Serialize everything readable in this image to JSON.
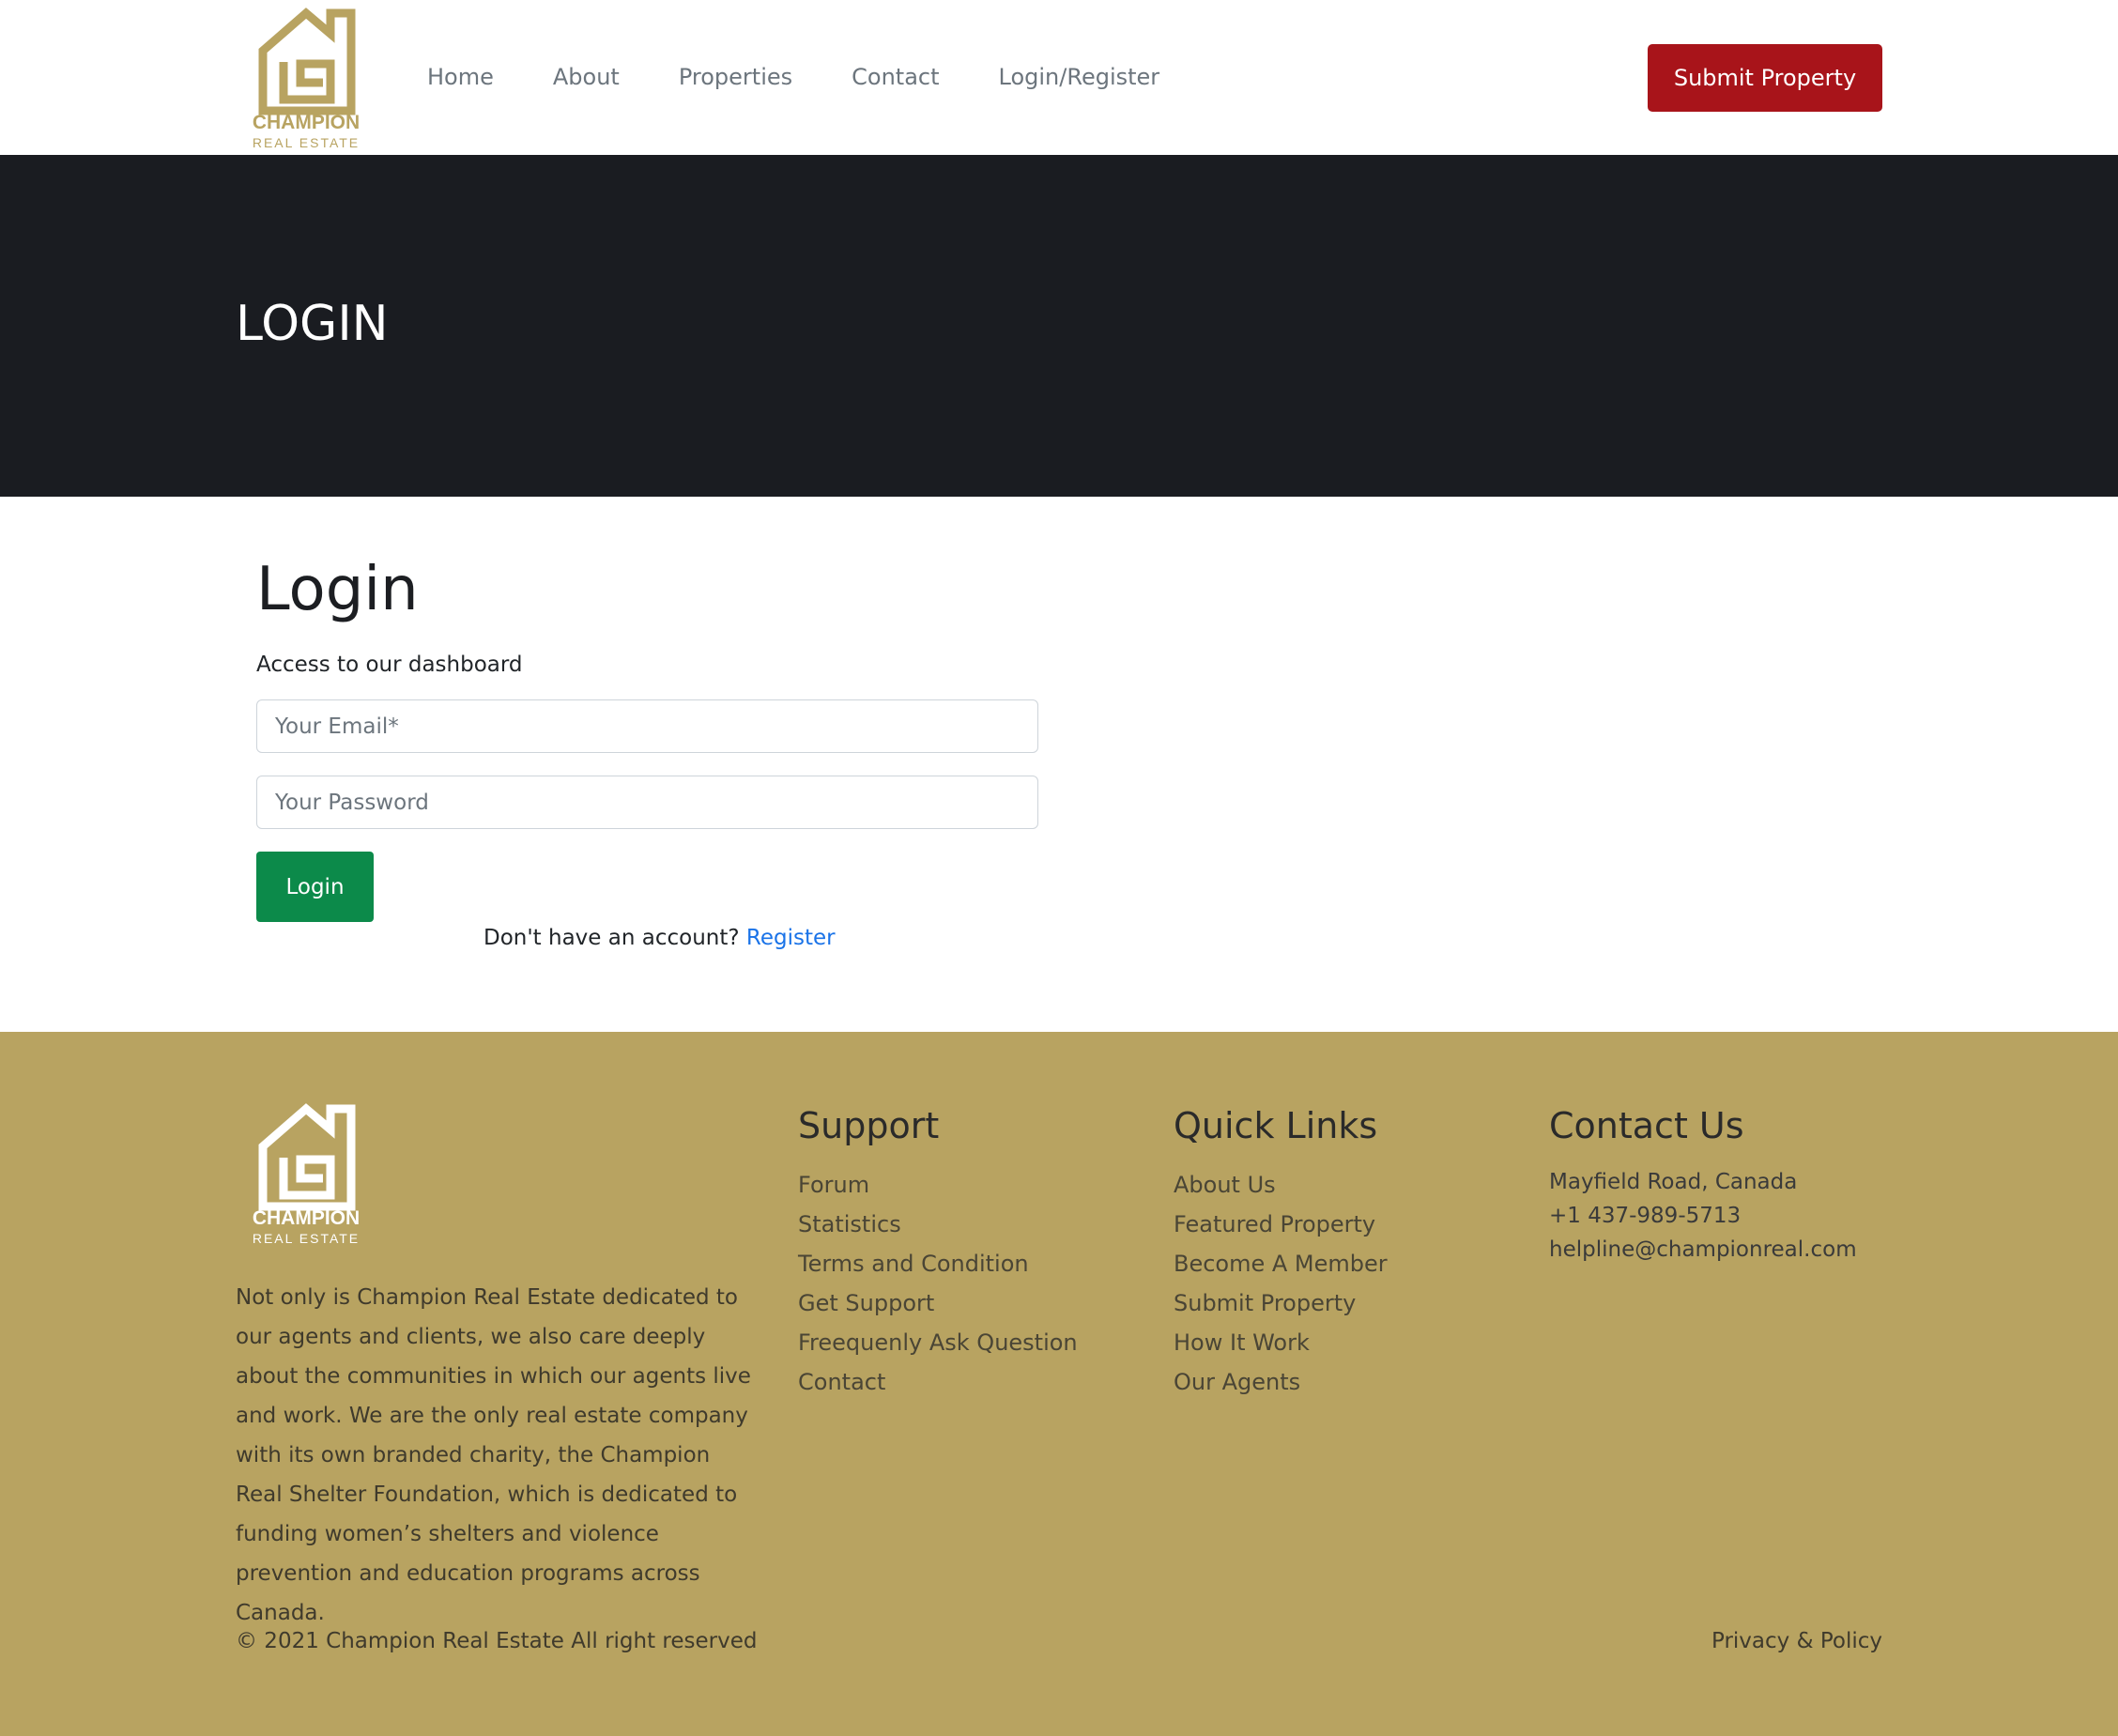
{
  "header": {
    "logo": {
      "brand": "CHAMPION",
      "tagline": "REAL ESTATE",
      "color": "#b8a361"
    },
    "nav": [
      {
        "label": "Home"
      },
      {
        "label": "About"
      },
      {
        "label": "Properties"
      },
      {
        "label": "Contact"
      },
      {
        "label": "Login/Register"
      }
    ],
    "submit_button": "Submit Property",
    "submit_button_color": "#a8141a"
  },
  "banner": {
    "title": "LOGIN",
    "background": "#1a1c21"
  },
  "login": {
    "heading": "Login",
    "subtitle": "Access to our dashboard",
    "email_placeholder": "Your Email*",
    "password_placeholder": "Your Password",
    "login_button": "Login",
    "login_button_color": "#0c8a4a",
    "no_account_text": "Don't have an account?",
    "register_link": "Register"
  },
  "footer": {
    "background": "#b8a361",
    "logo": {
      "brand": "CHAMPION",
      "tagline": "REAL ESTATE"
    },
    "about_text": "Not only is Champion Real Estate dedicated to our agents and clients, we also care deeply about the communities in which our agents live and work. We are the only real estate company with its own branded charity, the Champion Real Shelter Foundation, which is dedicated to funding women’s shelters and violence prevention and education programs across Canada.",
    "support": {
      "title": "Support",
      "links": [
        "Forum",
        "Statistics",
        "Terms and Condition",
        "Get Support",
        "Freequenly Ask Question",
        "Contact"
      ]
    },
    "quick_links": {
      "title": "Quick Links",
      "links": [
        "About Us",
        "Featured Property",
        "Become A Member",
        "Submit Property",
        "How It Work",
        "Our Agents"
      ]
    },
    "contact": {
      "title": "Contact Us",
      "address": "Mayfield Road, Canada",
      "phone": "+1 437-989-5713",
      "email": "helpline@championreal.com"
    },
    "copyright": "© 2021 Champion Real Estate All right reserved",
    "privacy": "Privacy & Policy"
  }
}
